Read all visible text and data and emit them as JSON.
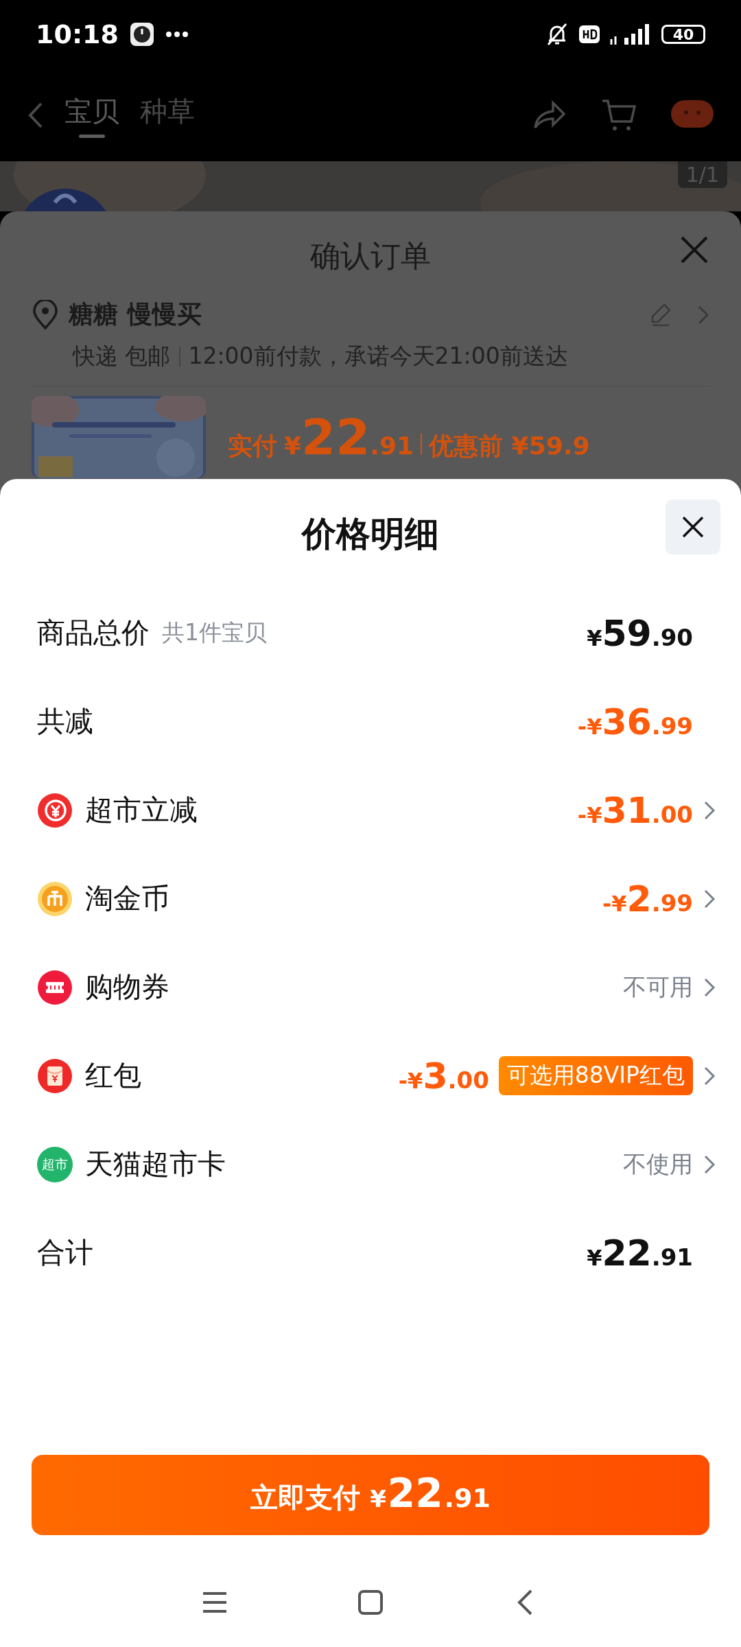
{
  "status_bar": {
    "time": "10:18",
    "battery": "40"
  },
  "header": {
    "tabs": [
      {
        "label": "宝贝",
        "selected": true
      },
      {
        "label": "种草",
        "selected": false
      }
    ]
  },
  "gallery": {
    "counter": "1/1"
  },
  "order_sheet": {
    "title": "确认订单",
    "address": {
      "name": "糖糖",
      "tag": "慢慢买"
    },
    "delivery": {
      "method": "快递 包邮",
      "promise": "12:00前付款，承诺今天21:00前送达"
    },
    "price": {
      "label": "实付",
      "prefix": "¥",
      "main": "22",
      "cents": ".91",
      "original": "优惠前 ¥59.9"
    }
  },
  "price_sheet": {
    "title": "价格明细",
    "rows": [
      {
        "label": "商品总价",
        "note": "共1件宝贝",
        "amount": {
          "prefix": "¥",
          "main": "59",
          "cents": ".90"
        },
        "discount": false,
        "link": false
      },
      {
        "label": "共减",
        "amount": {
          "prefix": "-¥",
          "main": "36",
          "cents": ".99"
        },
        "discount": true,
        "link": false
      },
      {
        "label": "超市立减",
        "amount": {
          "prefix": "-¥",
          "main": "31",
          "cents": ".00"
        },
        "discount": true,
        "link": true
      },
      {
        "label": "淘金币",
        "amount": {
          "prefix": "-¥",
          "main": "2",
          "cents": ".99"
        },
        "discount": true,
        "link": true
      },
      {
        "label": "购物券",
        "status": "不可用",
        "discount": false,
        "link": true
      },
      {
        "label": "红包",
        "amount": {
          "prefix": "-¥",
          "main": "3",
          "cents": ".00"
        },
        "badge": "可选用88VIP红包",
        "discount": true,
        "link": true
      },
      {
        "label": "天猫超市卡",
        "icon_text": "超市",
        "status": "不使用",
        "discount": false,
        "link": true
      },
      {
        "label": "合计",
        "amount": {
          "prefix": "¥",
          "main": "22",
          "cents": ".91"
        },
        "discount": false,
        "link": false
      }
    ],
    "pay_button": {
      "label": "立即支付",
      "prefix": "¥",
      "main": "22",
      "cents": ".91"
    }
  }
}
